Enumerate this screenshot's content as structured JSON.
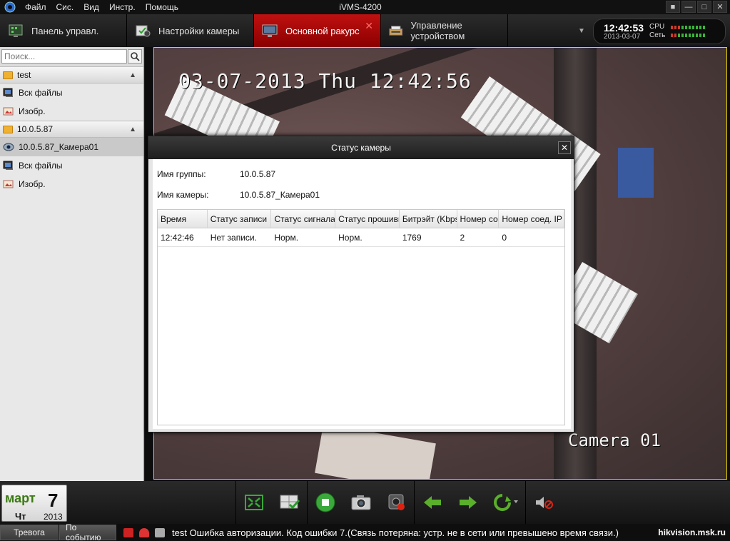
{
  "menubar": {
    "items": [
      "Файл",
      "Сис.",
      "Вид",
      "Инстр.",
      "Помощь"
    ],
    "app_title": "iVMS-4200"
  },
  "tabs": [
    {
      "label": "Панель управл.",
      "icon": "control-panel-icon"
    },
    {
      "label": "Настройки камеры",
      "icon": "camera-settings-icon"
    },
    {
      "label": "Основной ракурс",
      "icon": "main-view-icon",
      "active": true
    },
    {
      "label": "Управление устройством",
      "icon": "device-management-icon"
    }
  ],
  "status_clock": {
    "time": "12:42:53",
    "date": "2013-03-07",
    "cpu_label": "CPU",
    "net_label": "Сеть"
  },
  "search": {
    "placeholder": "Поиск..."
  },
  "tree": {
    "groups": [
      {
        "name": "test",
        "items": [
          {
            "label": "Вск файлы",
            "icon": "files-icon"
          },
          {
            "label": "Изобр.",
            "icon": "image-icon"
          }
        ]
      },
      {
        "name": "10.0.5.87",
        "items": [
          {
            "label": "10.0.5.87_Камера01",
            "icon": "camera-icon",
            "selected": true
          },
          {
            "label": "Вск файлы",
            "icon": "files-icon"
          },
          {
            "label": "Изобр.",
            "icon": "image-icon"
          }
        ]
      }
    ]
  },
  "video": {
    "osd_timestamp": "03-07-2013 Thu 12:42:56",
    "osd_camera": "Camera 01"
  },
  "dialog": {
    "title": "Статус камеры",
    "group_label": "Имя группы:",
    "group_value": "10.0.5.87",
    "camera_label": "Имя камеры:",
    "camera_value": "10.0.5.87_Камера01",
    "columns": [
      "Время",
      "Статус записи",
      "Статус сигнала",
      "Статус прошивки",
      "Битрэйт (Kbps)",
      "Номер соед.",
      "Номер соед. IP"
    ],
    "rows": [
      [
        "12:42:46",
        "Нет записи.",
        "Норм.",
        "Норм.",
        "1769",
        "2",
        "0"
      ]
    ]
  },
  "calendar": {
    "month": "март",
    "day": "7",
    "weekday": "Чт",
    "year": "2013"
  },
  "toolbar_icons": [
    "fullscreen-icon",
    "layout-icon",
    "stop-all-icon",
    "snapshot-icon",
    "record-icon",
    "previous-icon",
    "next-icon",
    "auto-switch-icon",
    "mute-icon"
  ],
  "statusbar": {
    "tab_alarm": "Тревога",
    "tab_event": "По событию",
    "message": "test Ошибка авторизации. Код ошибки 7.(Связь потеряна: устр. не в сети или превышено время связи.)",
    "site": "hikvision.msk.ru"
  },
  "colors": {
    "active_tab": "#a00000",
    "accent_green": "#3bb33b",
    "video_border": "#e6d200"
  }
}
